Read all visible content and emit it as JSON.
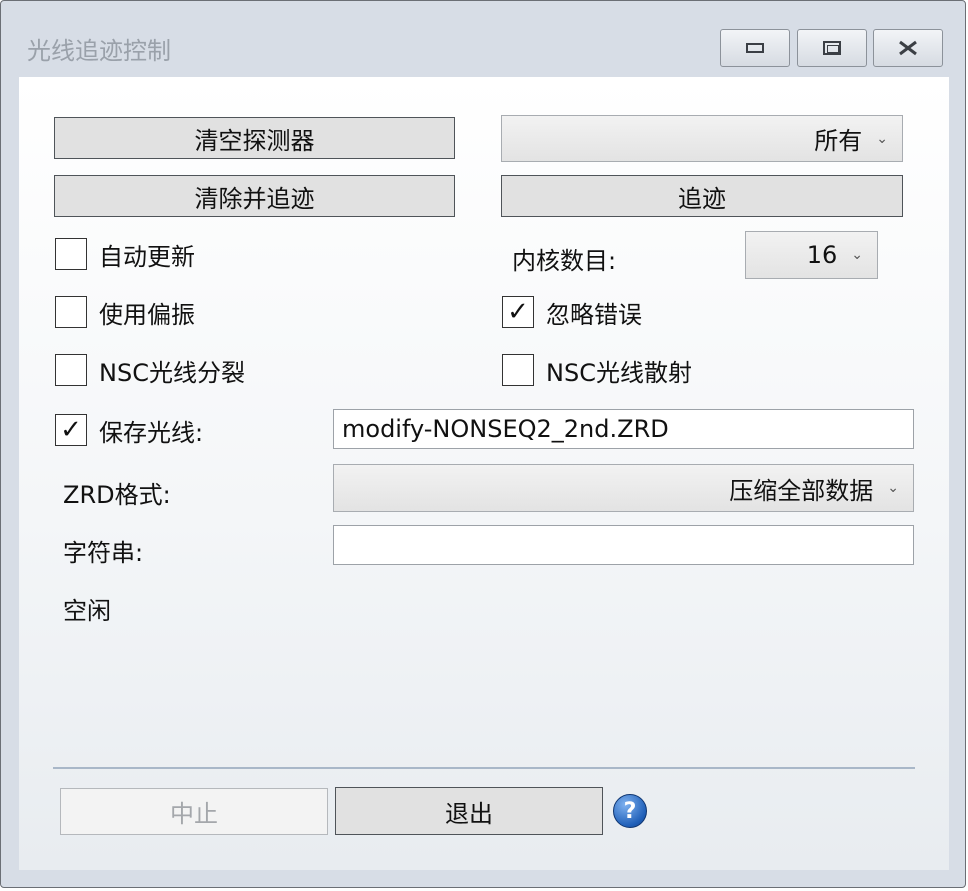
{
  "window": {
    "title": "光线追迹控制",
    "minimize_icon": "minimize-icon",
    "maximize_icon": "maximize-icon",
    "close_icon": "close-icon"
  },
  "buttons": {
    "clear_detectors": "清空探测器",
    "clear_and_trace": "清除并追迹",
    "trace": "追迹",
    "abort": "中止",
    "exit": "退出"
  },
  "detector_dropdown": {
    "selected": "所有"
  },
  "cores": {
    "label": "内核数目:",
    "selected": "16"
  },
  "checkboxes": {
    "auto_update": {
      "label": "自动更新",
      "checked": false
    },
    "use_polarization": {
      "label": "使用偏振",
      "checked": false
    },
    "ignore_errors": {
      "label": "忽略错误",
      "checked": true
    },
    "nsc_ray_splitting": {
      "label": "NSC光线分裂",
      "checked": false
    },
    "nsc_ray_scattering": {
      "label": "NSC光线散射",
      "checked": false
    },
    "save_rays": {
      "label": "保存光线:",
      "checked": true
    }
  },
  "save_file": {
    "value": "modify-NONSEQ2_2nd.ZRD"
  },
  "zrd_format": {
    "label": "ZRD格式:",
    "selected": "压缩全部数据"
  },
  "filter_string": {
    "label": "字符串:",
    "value": ""
  },
  "status": {
    "text": "空闲"
  },
  "check_glyph": "✓",
  "help_icon": "help-icon"
}
